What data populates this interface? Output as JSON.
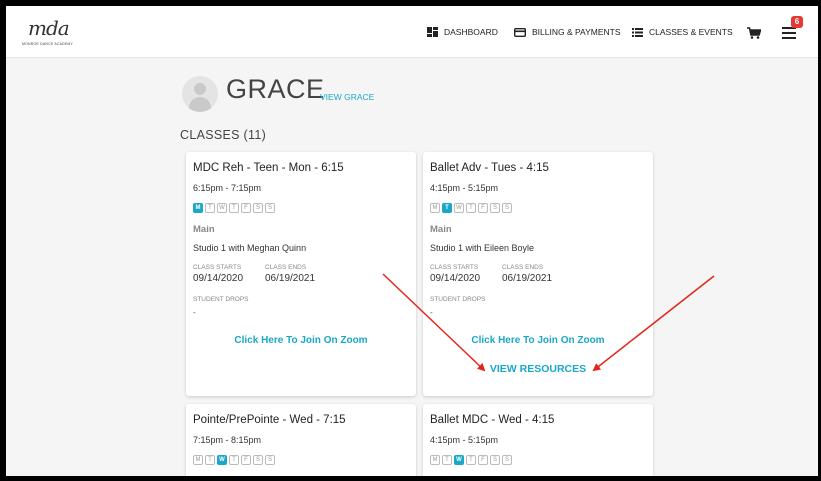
{
  "header": {
    "logo_script": "mda",
    "logo_subtitle": "MONROE DANCE ACADEMY",
    "nav": [
      {
        "label": "DASHBOARD",
        "icon": "dashboard-icon"
      },
      {
        "label": "BILLING & PAYMENTS",
        "icon": "credit-card-icon"
      },
      {
        "label": "CLASSES & EVENTS",
        "icon": "list-icon"
      }
    ],
    "cart_icon": "cart-icon",
    "menu_icon": "hamburger-menu-icon",
    "notification_count": "6"
  },
  "student": {
    "name": "GRACE",
    "view_link": "VIEW GRACE"
  },
  "classes_heading": "CLASSES (11)",
  "labels": {
    "class_starts": "CLASS STARTS",
    "class_ends": "CLASS ENDS",
    "student_drops": "STUDENT DROPS"
  },
  "cards": [
    {
      "title": "MDC Reh - Teen - Mon - 6:15",
      "time": "6:15pm - 7:15pm",
      "days": [
        "M",
        "T",
        "W",
        "T",
        "F",
        "S",
        "S"
      ],
      "active_day": 0,
      "location": "Main",
      "studio": "Studio 1 with Meghan Quinn",
      "starts": "09/14/2020",
      "ends": "06/19/2021",
      "drops": "-",
      "zoom": "Click Here To Join On Zoom"
    },
    {
      "title": "Ballet Adv - Tues - 4:15",
      "time": "4:15pm - 5:15pm",
      "days": [
        "M",
        "T",
        "W",
        "T",
        "F",
        "S",
        "S"
      ],
      "active_day": 1,
      "location": "Main",
      "studio": "Studio 1 with Eileen Boyle",
      "starts": "09/14/2020",
      "ends": "06/19/2021",
      "drops": "-",
      "zoom": "Click Here To Join On Zoom",
      "resources": "VIEW RESOURCES"
    },
    {
      "title": "Pointe/PrePointe - Wed - 7:15",
      "time": "7:15pm - 8:15pm",
      "days": [
        "M",
        "T",
        "W",
        "T",
        "F",
        "S",
        "S"
      ],
      "active_day": 2
    },
    {
      "title": "Ballet MDC - Wed - 4:15",
      "time": "4:15pm - 5:15pm",
      "days": [
        "M",
        "T",
        "W",
        "T",
        "F",
        "S",
        "S"
      ],
      "active_day": 2
    }
  ],
  "colors": {
    "accent": "#1aa8c9",
    "badge": "#e53935",
    "arrow": "#e3261c"
  }
}
